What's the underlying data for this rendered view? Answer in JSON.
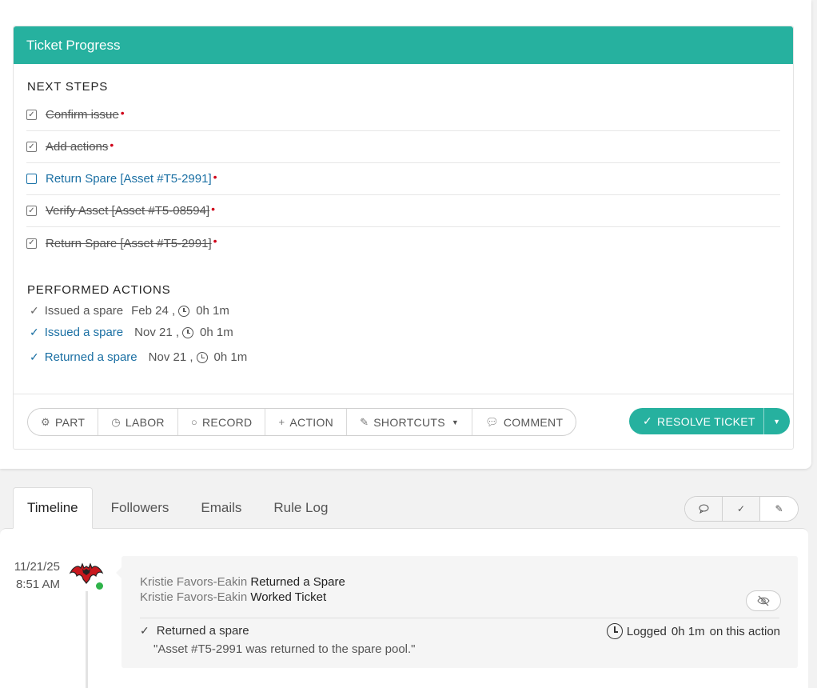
{
  "progress": {
    "title": "Ticket Progress",
    "next_steps_heading": "NEXT STEPS",
    "steps": [
      {
        "label": "Confirm issue",
        "done": true,
        "required": "•"
      },
      {
        "label": "Add actions",
        "done": true,
        "required": "•"
      },
      {
        "label": "Return Spare [Asset #T5-2991]",
        "done": false,
        "required": "•"
      },
      {
        "label": "Verify Asset [Asset #T5-08594]",
        "done": true,
        "required": "•"
      },
      {
        "label": "Return Spare [Asset #T5-2991]",
        "done": true,
        "required": "•"
      }
    ],
    "performed_heading": "PERFORMED ACTIONS",
    "performed": [
      {
        "name": "Issued a spare",
        "date": "Feb 24 ,",
        "duration": "0h 1m",
        "link": false
      },
      {
        "name": "Issued a spare",
        "date": "Nov 21 ,",
        "duration": "0h 1m",
        "link": true
      },
      {
        "name": "Returned a spare",
        "date": "Nov 21 ,",
        "duration": "0h 1m",
        "link": true
      }
    ]
  },
  "toolbar": {
    "part": "PART",
    "labor": "LABOR",
    "record": "RECORD",
    "action": "ACTION",
    "shortcuts": "SHORTCUTS",
    "comment": "COMMENT",
    "resolve": "RESOLVE TICKET"
  },
  "tabs": {
    "timeline": "Timeline",
    "followers": "Followers",
    "emails": "Emails",
    "rule_log": "Rule Log"
  },
  "timeline_entry": {
    "date": "11/21/25",
    "time": "8:51 AM",
    "user": "Kristie Favors-Eakin",
    "event1": "Returned a Spare",
    "event2": "Worked Ticket",
    "action_name": "Returned a spare",
    "note": "\"Asset #T5-2991 was returned to the spare pool.\"",
    "logged_label": "Logged",
    "logged_duration": "0h 1m",
    "logged_suffix": "on this action"
  },
  "colors": {
    "accent": "#26b19f",
    "link": "#1a6fa3",
    "required": "#d0021b",
    "online": "#2fb34a"
  }
}
